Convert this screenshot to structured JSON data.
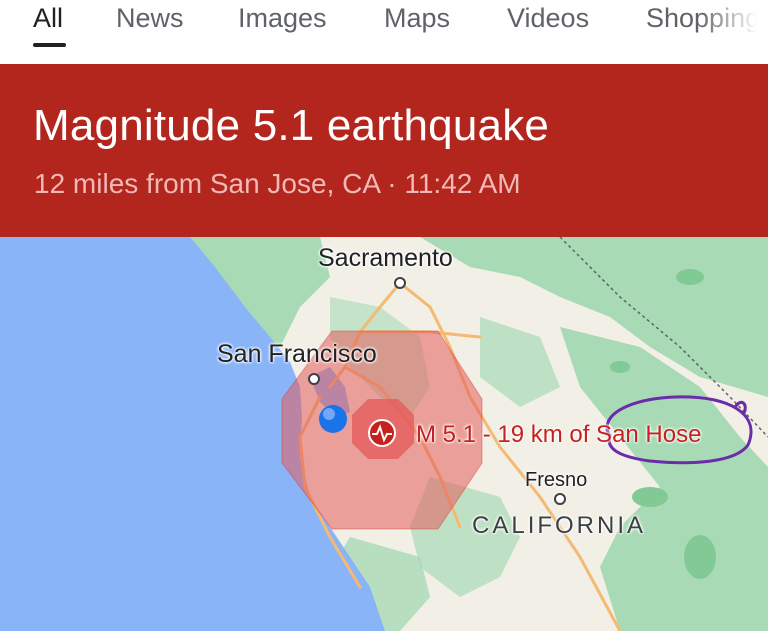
{
  "tabs": [
    {
      "label": "All",
      "active": true
    },
    {
      "label": "News",
      "active": false
    },
    {
      "label": "Images",
      "active": false
    },
    {
      "label": "Maps",
      "active": false
    },
    {
      "label": "Videos",
      "active": false
    },
    {
      "label": "Shopping",
      "active": false
    }
  ],
  "alert": {
    "headline": "Magnitude 5.1 earthquake",
    "subtitle": "12 miles from San Jose, CA · 11:42 AM",
    "banner_color": "#b3261e"
  },
  "map": {
    "labels": {
      "sacramento": "Sacramento",
      "san_francisco": "San Francisco",
      "fresno": "Fresno",
      "california": "CALIFORNIA"
    },
    "quake_label": "M 5.1 - 19 km of San Hose",
    "icons": {
      "epicenter": "seismograph-icon",
      "location": "my-location-dot-icon"
    },
    "colors": {
      "water": "#8ab4f8",
      "land_green": "#a8dab5",
      "land": "#f1efe6",
      "quake_area": "#e35d5b",
      "annotation": "#6a2ca8"
    }
  }
}
